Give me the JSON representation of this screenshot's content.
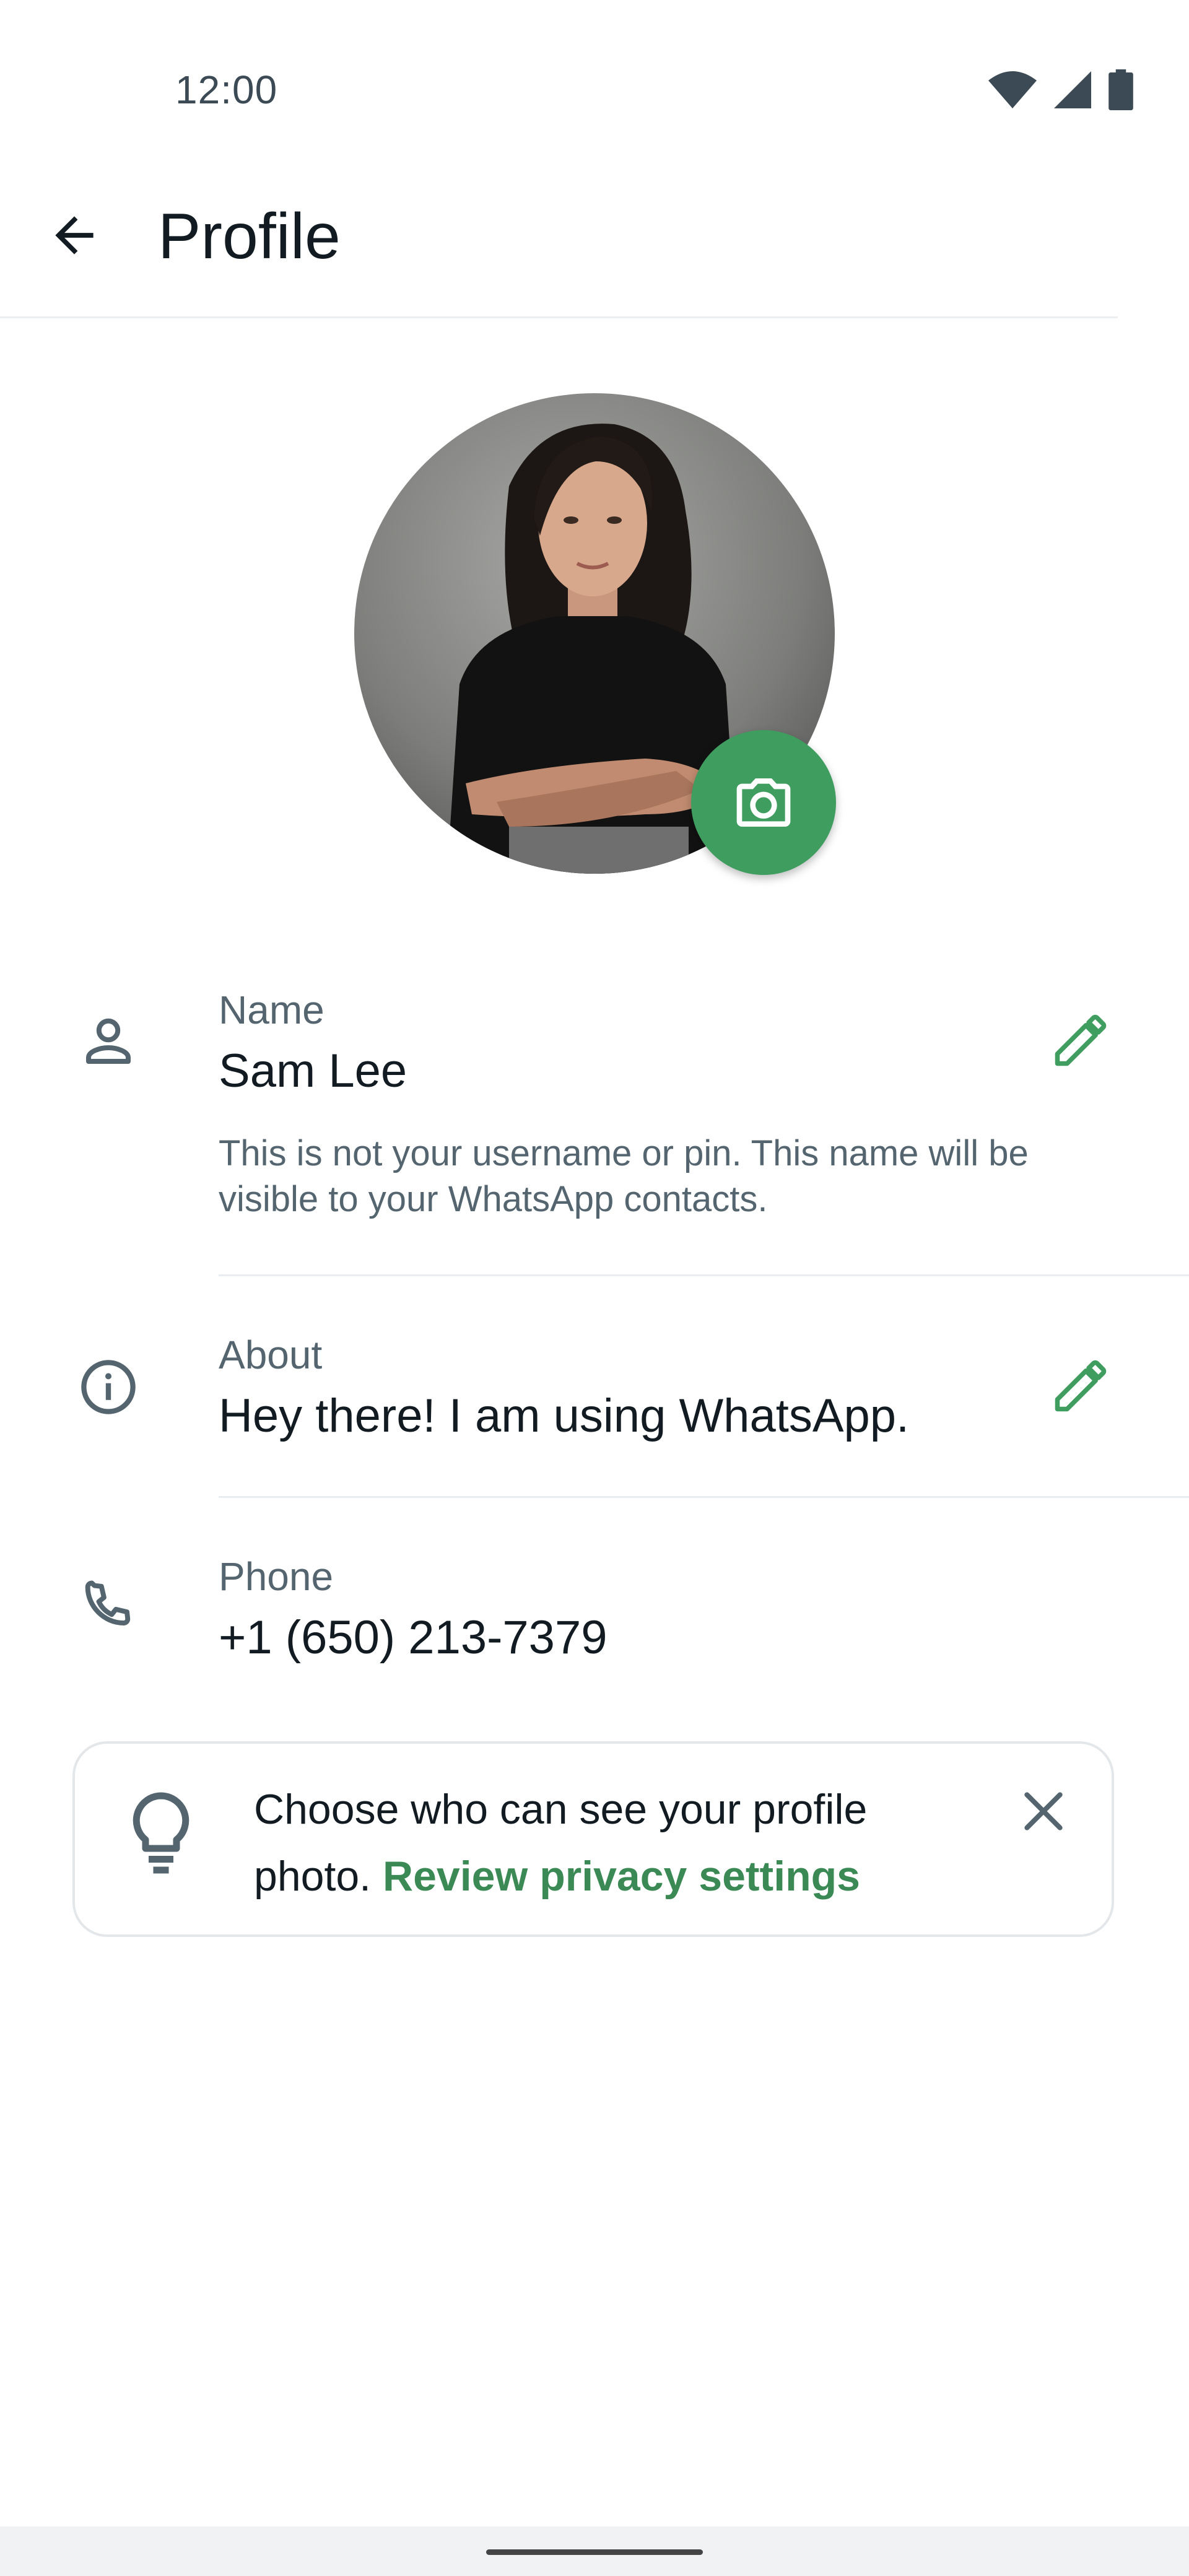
{
  "status_bar": {
    "time": "12:00",
    "icons": [
      "wifi-icon",
      "signal-icon",
      "battery-icon"
    ]
  },
  "app_bar": {
    "title": "Profile",
    "back_icon": "arrow-left-icon"
  },
  "profile": {
    "photo_alt": "Profile photo",
    "camera_icon": "camera-icon",
    "name": {
      "label": "Name",
      "value": "Sam Lee",
      "help": "This is not your username or pin. This name will be visible to your WhatsApp contacts.",
      "icon": "person-icon",
      "edit_icon": "pencil-icon"
    },
    "about": {
      "label": "About",
      "value": "Hey there! I am using WhatsApp.",
      "icon": "info-icon",
      "edit_icon": "pencil-icon"
    },
    "phone": {
      "label": "Phone",
      "value": "+1 (650) 213-7379",
      "icon": "phone-icon"
    }
  },
  "privacy_card": {
    "text": "Choose who can see your profile photo.",
    "link": "Review privacy settings",
    "icon": "lightbulb-icon",
    "close_icon": "close-icon"
  },
  "colors": {
    "accent": "#3f9d5f",
    "link": "#3b8a55",
    "text_secondary": "#54656f"
  }
}
